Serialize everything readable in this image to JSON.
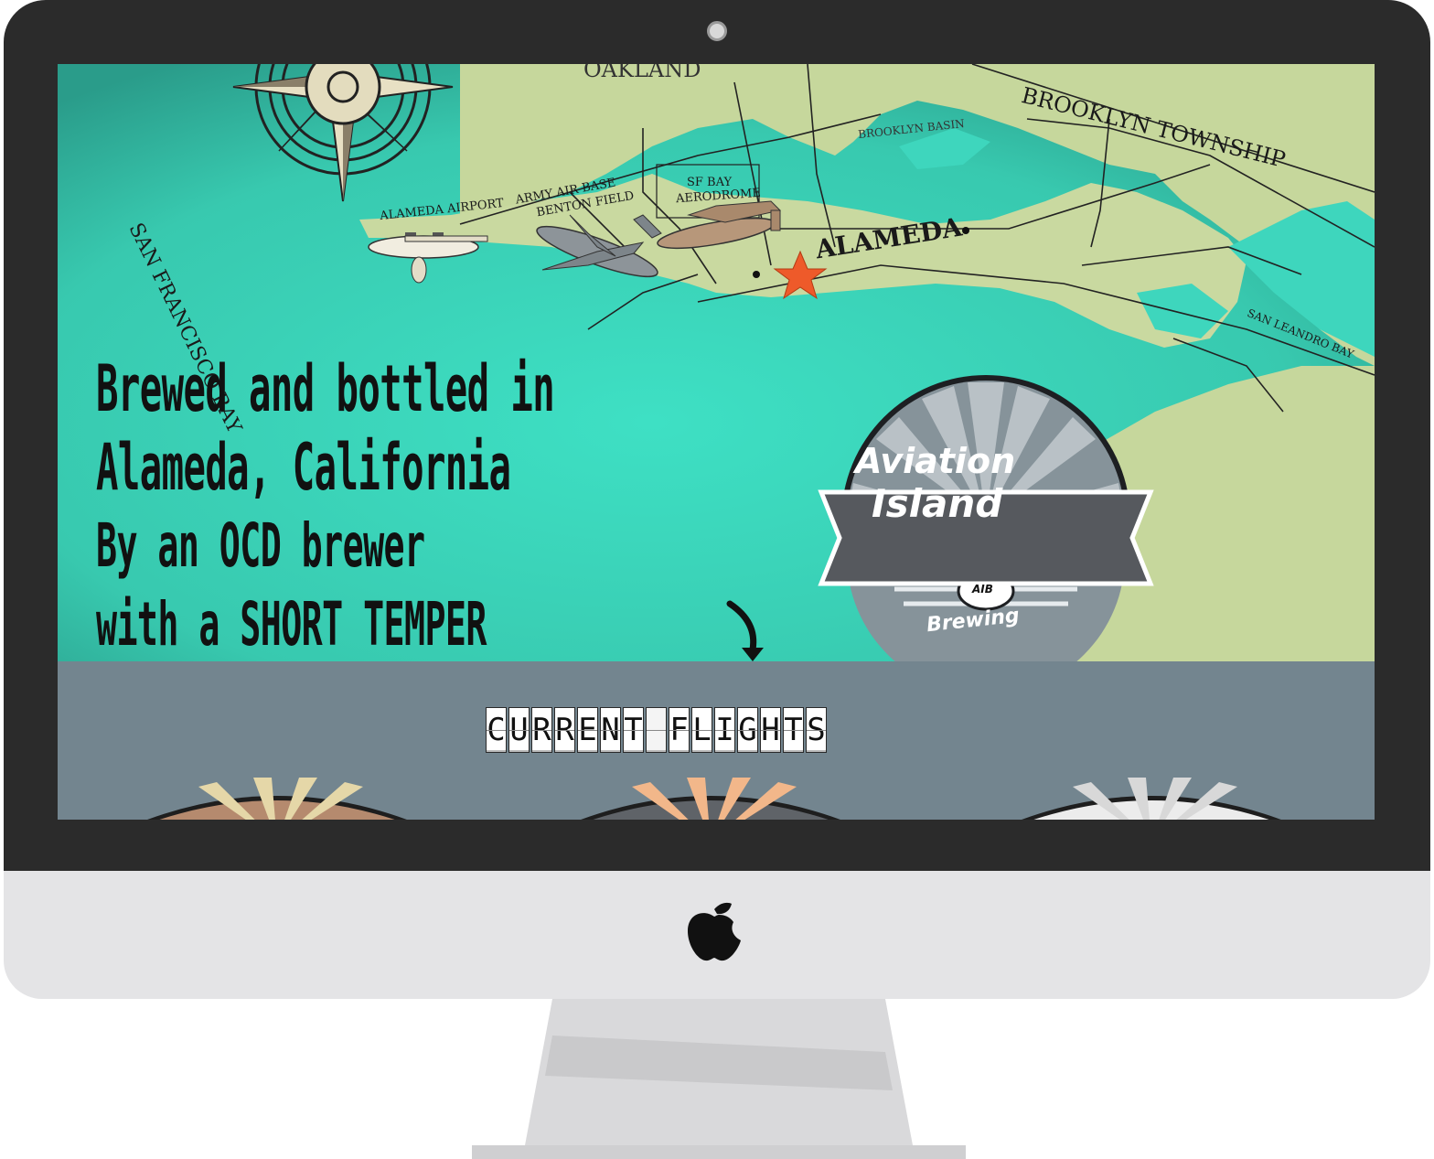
{
  "device": {
    "brand_icon": "apple-icon",
    "colors": {
      "bezel": "#2b2b2b",
      "chin": "#e4e4e6"
    }
  },
  "page": {
    "map": {
      "labels": {
        "top_cut": "OAKLAND",
        "san_francisco_bay": "SAN FRANCISCO BAY",
        "alameda_airport": "ALAMEDA AIRPORT",
        "army_air_base": "ARMY AIR BASE",
        "benton_field": "BENTON FIELD",
        "sf_bay": "SF BAY",
        "aerodrome": "AERODROME",
        "alameda": "ALAMEDA",
        "brooklyn_basin": "BROOKLYN BASIN",
        "brooklyn_township": "BROOKLYN TOWNSHIP",
        "san_leandro_bay": "SAN LEANDRO BAY"
      },
      "icons": [
        "compass-rose-icon",
        "seaplane-icon",
        "cargo-plane-icon",
        "bomber-plane-icon",
        "location-star-icon",
        "down-arrow-icon"
      ],
      "colors": {
        "water": "#3fd1bb",
        "land": "#c4d59a",
        "star": "#ee5a2a"
      }
    },
    "hero": {
      "lines": [
        "Brewed and bottled in",
        "Alameda, California",
        "By an OCD brewer",
        "with a SHORT TEMPER"
      ]
    },
    "logo": {
      "line1": "Aviation",
      "line2": "Island",
      "emblem": "AIB",
      "tagline": "Brewing"
    },
    "section": {
      "title": "CURRENT FLIGHTS",
      "title_tiles": [
        "C",
        "U",
        "R",
        "R",
        "E",
        "N",
        "T",
        " ",
        "F",
        "L",
        "I",
        "G",
        "H",
        "T",
        "S"
      ]
    }
  }
}
